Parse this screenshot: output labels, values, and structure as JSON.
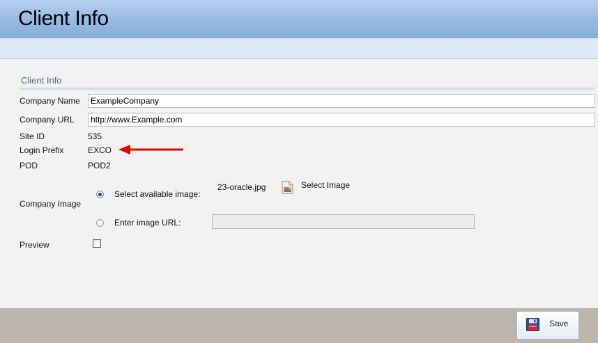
{
  "header": {
    "title": "Client Info"
  },
  "section": {
    "title": "Client Info"
  },
  "fields": {
    "company_name": {
      "label": "Company Name",
      "value": "ExampleCompany"
    },
    "company_url": {
      "label": "Company URL",
      "value": "http://www.Example.com"
    },
    "site_id": {
      "label": "Site ID",
      "value": "535"
    },
    "login_prefix": {
      "label": "Login Prefix",
      "value": "EXCO"
    },
    "pod": {
      "label": "POD",
      "value": "POD2"
    }
  },
  "company_image": {
    "label": "Company Image",
    "option_available": {
      "label": "Select available image:",
      "selected": true
    },
    "file_name": "23-oracle.jpg",
    "select_image_label": "Select Image",
    "option_url": {
      "label": "Enter image URL:",
      "selected": false,
      "value": ""
    }
  },
  "preview": {
    "label": "Preview",
    "checked": false
  },
  "footer": {
    "save_label": "Save"
  },
  "colors": {
    "header": "#9bbde6",
    "arrow": "#e60000",
    "footer": "#bcb5ab"
  },
  "icons": {
    "select_image": "image-file-icon",
    "save": "floppy-disk-icon",
    "annotation": "red-arrow-icon"
  }
}
